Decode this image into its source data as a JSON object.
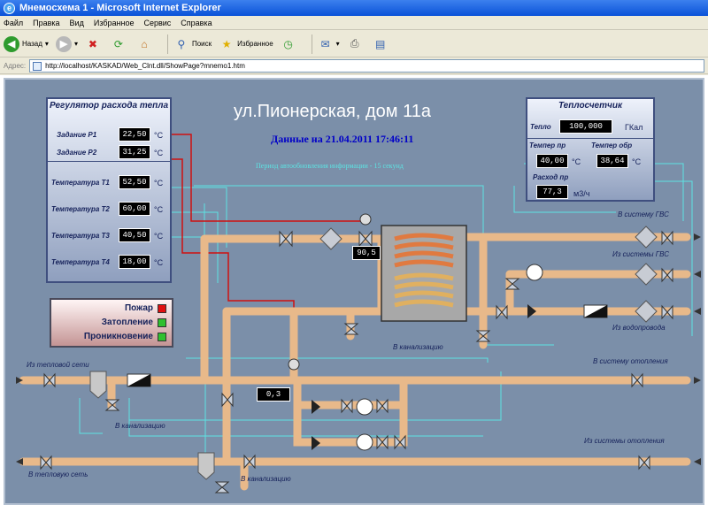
{
  "window": {
    "title": "Мнемосхема 1 - Microsoft Internet Explorer"
  },
  "menu": [
    "Файл",
    "Правка",
    "Вид",
    "Избранное",
    "Сервис",
    "Справка"
  ],
  "toolbar": {
    "back": "Назад",
    "search": "Поиск",
    "favorites": "Избранное"
  },
  "address": {
    "label": "Адрес:",
    "url": "http://localhost/KASKAD/Web_Clnt.dll/ShowPage?mnemo1.htm"
  },
  "page": {
    "heading": "ул.Пионерская, дом 11а",
    "date": "Данные на 21.04.2011 17:46:11",
    "period": "Период автообновления информации - 15 секунд"
  },
  "regulator": {
    "title": "Регулятор расхода тепла",
    "setpoints": [
      {
        "label": "Задание Р1",
        "value": "22,50",
        "unit": "°C"
      },
      {
        "label": "Задание Р2",
        "value": "31,25",
        "unit": "°C"
      }
    ],
    "temps": [
      {
        "label": "Температура Т1",
        "value": "52,50",
        "unit": "°C"
      },
      {
        "label": "Температура Т2",
        "value": "60,00",
        "unit": "°C"
      },
      {
        "label": "Температура Т3",
        "value": "40,50",
        "unit": "°C"
      },
      {
        "label": "Температура Т4",
        "value": "18,00",
        "unit": "°C"
      }
    ]
  },
  "heatmeter": {
    "title": "Теплосчетчик",
    "heat_label": "Тепло",
    "heat_value": "100,000",
    "heat_unit": "ГКал",
    "t_supply_label": "Темпер пр",
    "t_supply_value": "40,00",
    "t_supply_unit": "°C",
    "t_return_label": "Темпер обр",
    "t_return_value": "38,64",
    "t_return_unit": "°C",
    "flow_label": "Расход пр",
    "flow_value": "77,3",
    "flow_unit": "м3/ч"
  },
  "alarms": [
    {
      "label": "Пожар",
      "color": "#e01010"
    },
    {
      "label": "Затопление",
      "color": "#30c030"
    },
    {
      "label": "Проникновение",
      "color": "#30c030"
    }
  ],
  "readouts": {
    "valve_top": "90,5",
    "valve_bottom": "0,3"
  },
  "pipe_labels": {
    "to_hws": "В систему ГВС",
    "from_hws": "Из системы ГВС",
    "from_water": "Из водопровода",
    "sewer_mid": "В канализацию",
    "to_heating": "В систему отопления",
    "from_heat_net": "Из тепловой сети",
    "sewer_left": "В канализацию",
    "from_heating": "Из системы отопления",
    "to_heat_net": "В тепловую сеть",
    "sewer_bottom": "В канализацию"
  },
  "colors": {
    "pipe": "#e8b98a",
    "bg": "#7b8fa9",
    "signal_red": "#d01010",
    "signal_cyan": "#5de3e3"
  }
}
